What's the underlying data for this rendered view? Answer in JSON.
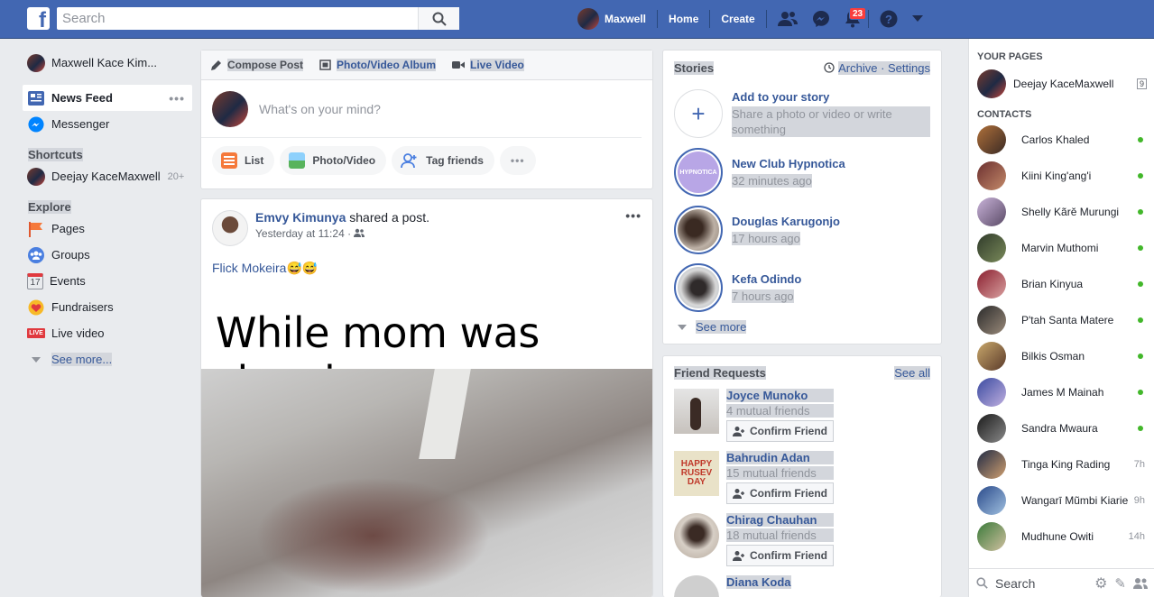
{
  "topbar": {
    "search_placeholder": "Search",
    "user_name": "Maxwell",
    "home": "Home",
    "create": "Create",
    "notifications_count": "23"
  },
  "leftnav": {
    "profile": "Maxwell Kace Kim...",
    "items": [
      {
        "label": "News Feed"
      },
      {
        "label": "Messenger"
      }
    ],
    "shortcuts_heading": "Shortcuts",
    "shortcut": {
      "label": "Deejay KaceMaxwell",
      "count": "20+"
    },
    "explore_heading": "Explore",
    "explore": [
      {
        "label": "Pages"
      },
      {
        "label": "Groups"
      },
      {
        "label": "Events"
      },
      {
        "label": "Fundraisers"
      },
      {
        "label": "Live video"
      }
    ],
    "events_day": "17",
    "live_badge": "LIVE",
    "see_more": "See more..."
  },
  "composer": {
    "tabs": [
      "Compose Post",
      "Photo/Video Album",
      "Live Video"
    ],
    "placeholder": "What's on your mind?",
    "actions": [
      "List",
      "Photo/Video",
      "Tag friends"
    ]
  },
  "post": {
    "author": "Emvy Kimunya",
    "action": " shared a post.",
    "time": "Yesterday at 11:24 · ",
    "text": "Flick Mokeira😅😅",
    "meme_text": "While mom was sleeping..."
  },
  "stories": {
    "title": "Stories",
    "archive": "Archive",
    "settings": "Settings",
    "add_title": "Add to your story",
    "add_sub": "Share a photo or video or write something",
    "items": [
      {
        "name": "New Club Hypnotica",
        "time": "32 minutes ago"
      },
      {
        "name": "Douglas Karugonjo",
        "time": "17 hours ago"
      },
      {
        "name": "Kefa Odindo",
        "time": "7 hours ago"
      }
    ],
    "see_more": "See more"
  },
  "friend_requests": {
    "title": "Friend Requests",
    "see_all": "See all",
    "confirm": "Confirm Friend",
    "items": [
      {
        "name": "Joyce Munoko",
        "mutual": "4 mutual friends"
      },
      {
        "name": "Bahrudin Adan",
        "mutual": "15 mutual friends"
      },
      {
        "name": "Chirag Chauhan",
        "mutual": "18 mutual friends"
      },
      {
        "name": "Diana Koda",
        "mutual": ""
      }
    ],
    "happy_text": "HAPPY RUSEV DAY"
  },
  "rightbar": {
    "pages_heading": "YOUR PAGES",
    "page": {
      "name": "Deejay KaceMaxwell",
      "count": "9"
    },
    "contacts_heading": "CONTACTS",
    "contacts": [
      {
        "name": "Carlos Khaled",
        "status": ""
      },
      {
        "name": "Kiini King'ang'i",
        "status": ""
      },
      {
        "name": "Shelly Kãrĕ Murungi",
        "status": ""
      },
      {
        "name": "Marvin Muthomi",
        "status": ""
      },
      {
        "name": "Brian Kinyua",
        "status": ""
      },
      {
        "name": "P'tah Santa Matere",
        "status": ""
      },
      {
        "name": "Bilkis Osman",
        "status": ""
      },
      {
        "name": "James M Mainah",
        "status": ""
      },
      {
        "name": "Sandra Mwaura",
        "status": ""
      },
      {
        "name": "Tinga King Rading",
        "status": "7h"
      },
      {
        "name": "Wangarī Mũmbi Kiarie",
        "status": "9h"
      },
      {
        "name": "Mudhune Owiti",
        "status": "14h"
      }
    ],
    "search_placeholder": "Search"
  },
  "colors": {
    "brand": "#4267b2",
    "link": "#365899",
    "online": "#42b72a",
    "badge": "#fa3e3e"
  }
}
